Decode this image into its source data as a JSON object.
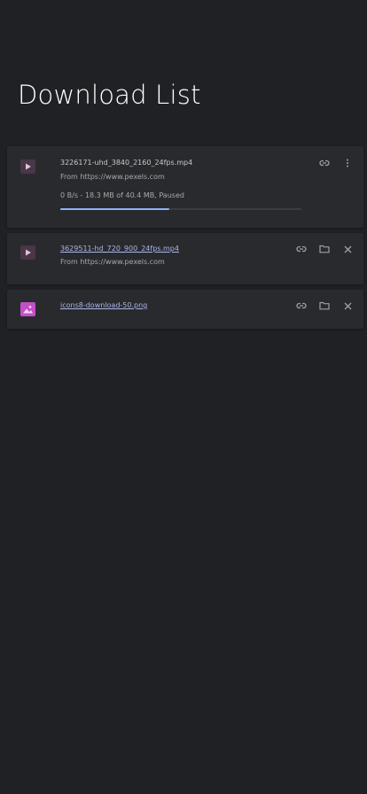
{
  "header": {
    "title": "Download List"
  },
  "downloads": [
    {
      "file_name": "3226171-uhd_3840_2160_24fps.mp4",
      "source": "From https://www.pexels.com",
      "status": "0 B/s - 18.3 MB of 40.4 MB, Paused",
      "progress": 0.453,
      "file_type_icon": "video-file-icon",
      "actions": [
        "link-icon",
        "more-vert-icon"
      ]
    },
    {
      "file_name": "3629511-hd_720_900_24fps.mp4",
      "source": "From https://www.pexels.com",
      "file_type_icon": "video-file-icon",
      "actions": [
        "link-icon",
        "folder-icon",
        "close-icon"
      ]
    },
    {
      "file_name": "icons8-download-50.png",
      "file_type_icon": "image-file-icon",
      "actions": [
        "link-icon",
        "folder-icon",
        "close-icon"
      ]
    }
  ],
  "colors": {
    "background": "#202124",
    "card": "#292a2d",
    "progress": "#8ab4f8",
    "link_text": "#aab7e8",
    "image_icon": "#c44fc9"
  }
}
